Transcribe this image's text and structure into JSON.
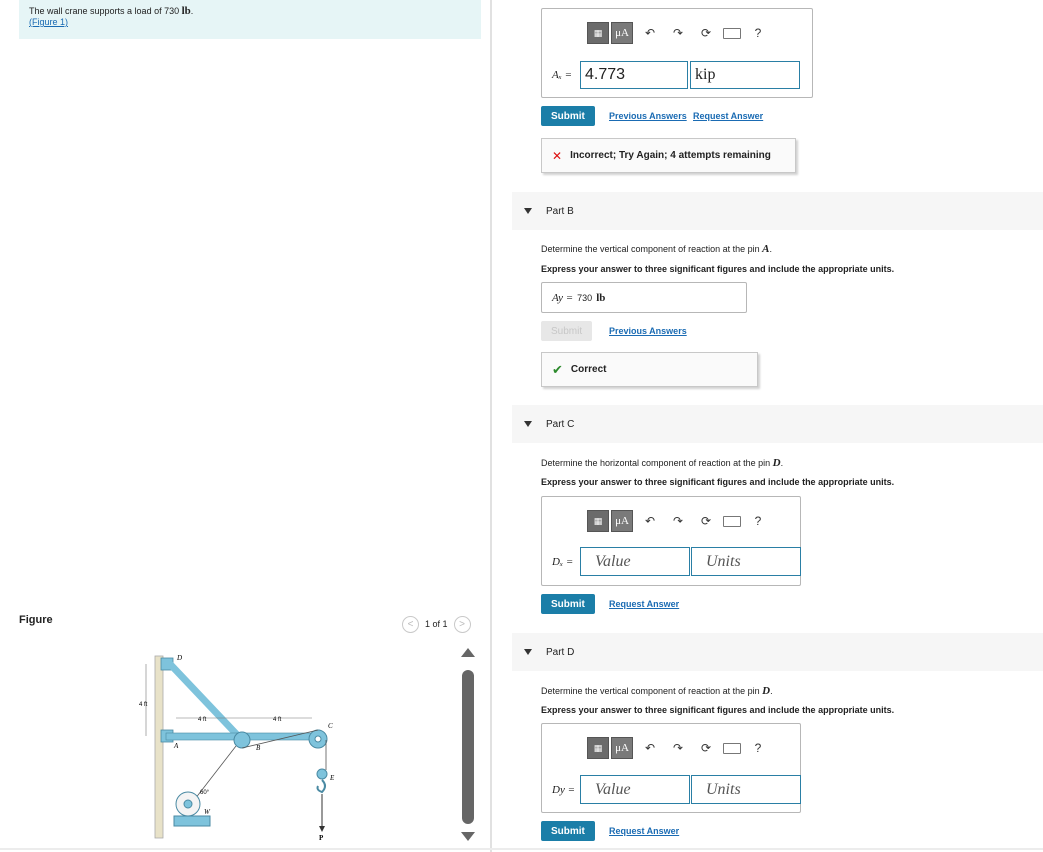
{
  "problem": {
    "text": "The wall crane supports a load of 730",
    "unit": "lb",
    "suffix": ".",
    "figure_link": "(Figure 1)"
  },
  "figure": {
    "label": "Figure",
    "pager_text": "1 of 1",
    "prev_glyph": "<",
    "next_glyph": ">",
    "diagram_labels": {
      "D": "D",
      "A": "A",
      "B": "B",
      "C": "C",
      "E": "E",
      "W": "W",
      "P": "P",
      "dim_vertical": "4 ft",
      "dim_ab": "4 ft",
      "dim_bc": "4 ft",
      "angle": "60°"
    }
  },
  "toolbar": {
    "units_glyph": "μA",
    "undo_glyph": "↶",
    "redo_glyph": "↷",
    "reset_glyph": "⟳",
    "help_glyph": "?"
  },
  "part_a": {
    "var_label": "Aₓ =",
    "value": "4.773",
    "units": "kip",
    "submit": "Submit",
    "previous_answers": "Previous Answers",
    "request_answer": "Request Answer",
    "feedback": "Incorrect; Try Again; 4 attempts remaining",
    "feedback_icon": "✕"
  },
  "part_b": {
    "title": "Part B",
    "prompt": "Determine the vertical component of reaction at the pin",
    "prompt_symbol": "A",
    "instruction": "Express your answer to three significant figures and include the appropriate units.",
    "var_label": "Ay =",
    "answer_value": "730",
    "answer_unit": "lb",
    "submit": "Submit",
    "previous_answers": "Previous Answers",
    "feedback": "Correct",
    "feedback_icon": "✔"
  },
  "part_c": {
    "title": "Part C",
    "prompt": "Determine the horizontal component of reaction at the pin",
    "prompt_symbol": "D",
    "instruction": "Express your answer to three significant figures and include the appropriate units.",
    "var_label": "Dₓ =",
    "value_placeholder": "Value",
    "units_placeholder": "Units",
    "submit": "Submit",
    "request_answer": "Request Answer"
  },
  "part_d": {
    "title": "Part D",
    "prompt": "Determine the vertical component of reaction at the pin",
    "prompt_symbol": "D",
    "instruction": "Express your answer to three significant figures and include the appropriate units.",
    "var_label": "Dy =",
    "value_placeholder": "Value",
    "units_placeholder": "Units",
    "submit": "Submit",
    "request_answer": "Request Answer"
  },
  "colors": {
    "accent": "#1b7ea8",
    "link": "#1a6bb3",
    "crane": "#7ec3dc",
    "problem_bg": "#e6f5f6"
  }
}
